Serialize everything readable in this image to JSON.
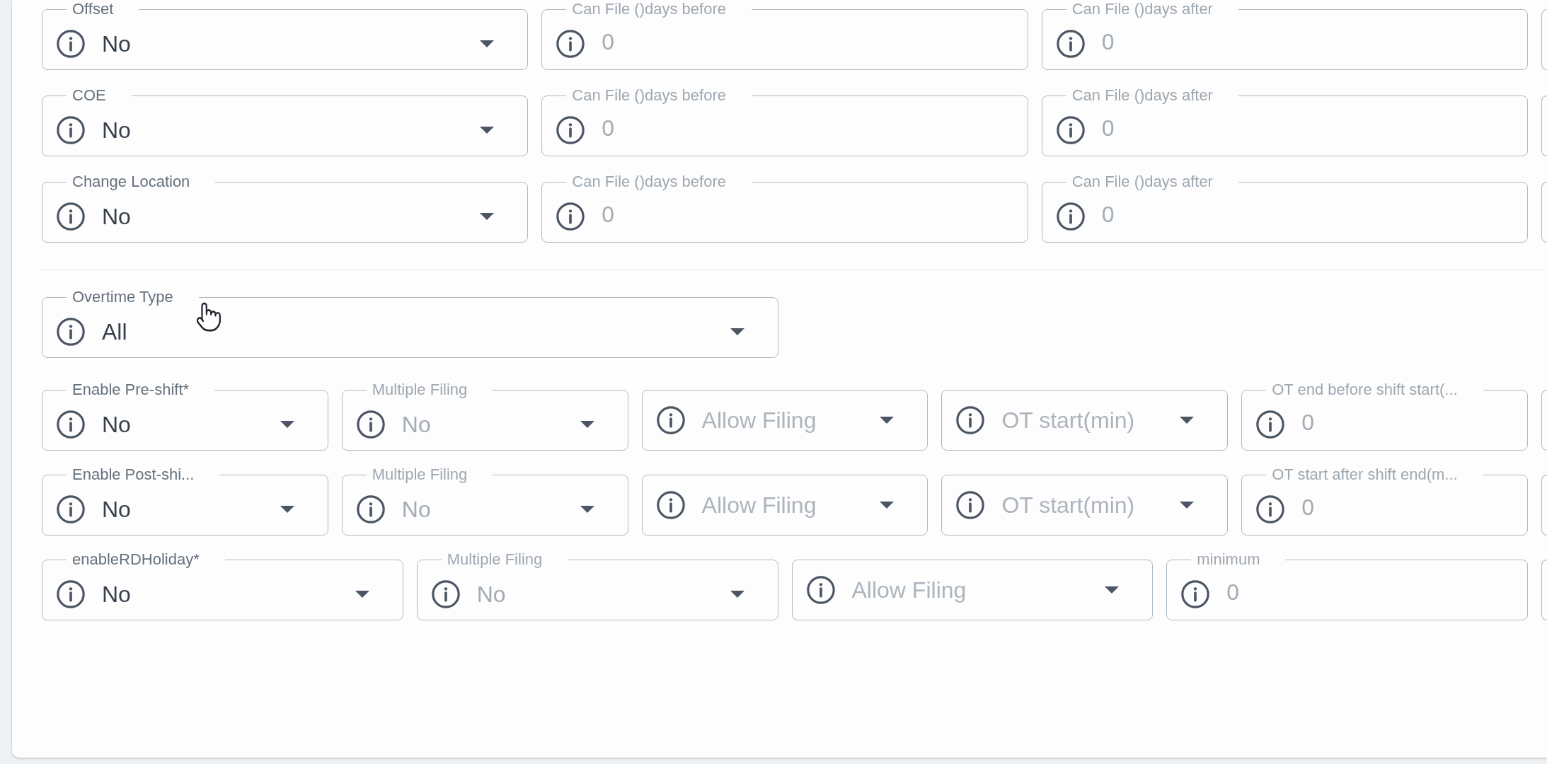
{
  "filing_settings": [
    {
      "fields": [
        {
          "kind": "select",
          "label": "Offset",
          "value": "No",
          "disabled": false
        },
        {
          "kind": "number",
          "label": "Can File ()days before",
          "value": "0",
          "disabled": true
        },
        {
          "kind": "number",
          "label": "Can File ()days after",
          "value": "0",
          "disabled": true
        },
        {
          "kind": "cut_off"
        }
      ]
    },
    {
      "fields": [
        {
          "kind": "select",
          "label": "COE",
          "value": "No",
          "disabled": false
        },
        {
          "kind": "number",
          "label": "Can File ()days before",
          "value": "0",
          "disabled": true
        },
        {
          "kind": "number",
          "label": "Can File ()days after",
          "value": "0",
          "disabled": true
        },
        {
          "kind": "cut_off"
        }
      ]
    },
    {
      "fields": [
        {
          "kind": "select",
          "label": "Change Location",
          "value": "No",
          "disabled": false
        },
        {
          "kind": "number",
          "label": "Can File ()days before",
          "value": "0",
          "disabled": true
        },
        {
          "kind": "number",
          "label": "Can File ()days after",
          "value": "0",
          "disabled": true
        },
        {
          "kind": "cut_off"
        }
      ]
    }
  ],
  "overtime_type": {
    "kind": "select",
    "label": "Overtime Type",
    "value": "All",
    "disabled": false
  },
  "overtime_rules": [
    {
      "fields": [
        {
          "kind": "select",
          "label": "Enable Pre-shift*",
          "value": "No",
          "disabled": false
        },
        {
          "kind": "select",
          "label": "Multiple Filing",
          "value": "No",
          "disabled": true
        },
        {
          "kind": "select",
          "placeholder": "Allow Filing",
          "disabled": true
        },
        {
          "kind": "select",
          "placeholder": "OT start(min)",
          "disabled": true
        },
        {
          "kind": "number",
          "label": "OT end before shift start(...",
          "value": "0",
          "disabled": true
        },
        {
          "kind": "cut_off"
        }
      ]
    },
    {
      "fields": [
        {
          "kind": "select",
          "label": "Enable Post-shi...",
          "value": "No",
          "disabled": false
        },
        {
          "kind": "select",
          "label": "Multiple Filing",
          "value": "No",
          "disabled": true
        },
        {
          "kind": "select",
          "placeholder": "Allow Filing",
          "disabled": true
        },
        {
          "kind": "select",
          "placeholder": "OT start(min)",
          "disabled": true
        },
        {
          "kind": "number",
          "label": "OT start after shift end(m...",
          "value": "0",
          "disabled": true
        },
        {
          "kind": "cut_off"
        }
      ]
    },
    {
      "fields": [
        {
          "kind": "select",
          "label": "enableRDHoliday*",
          "value": "No",
          "disabled": false
        },
        {
          "kind": "select",
          "label": "Multiple Filing",
          "value": "No",
          "disabled": true
        },
        {
          "kind": "select",
          "placeholder": "Allow Filing",
          "disabled": true
        },
        {
          "kind": "number",
          "label": "minimum",
          "value": "0",
          "disabled": true
        },
        {
          "kind": "cut_off"
        }
      ]
    }
  ]
}
